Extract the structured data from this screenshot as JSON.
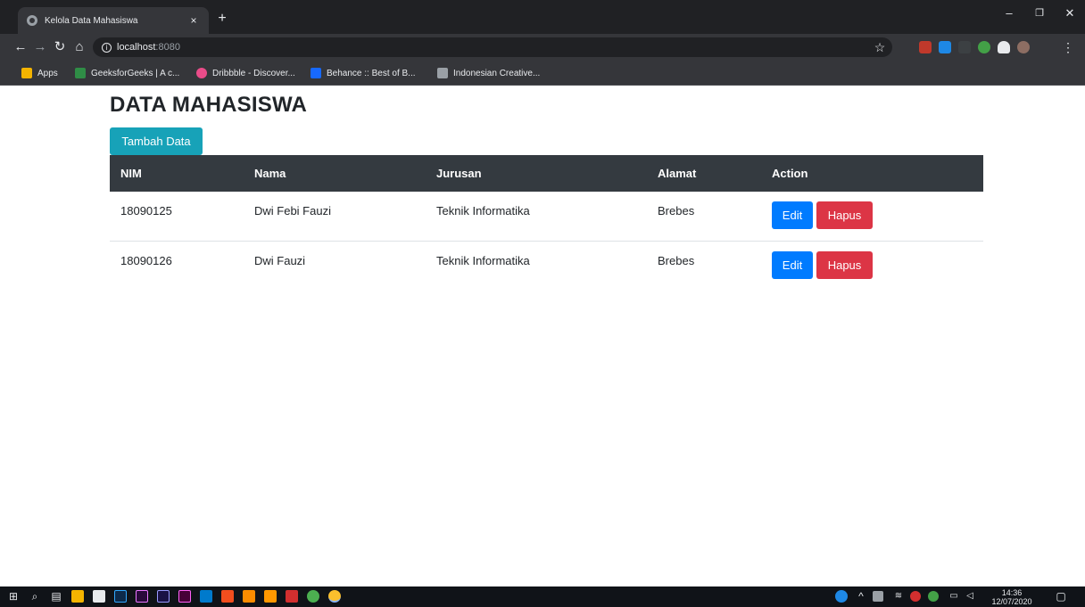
{
  "browser": {
    "tab_title": "Kelola Data Mahasiswa",
    "tab_close": "×",
    "new_tab": "+",
    "url_host": "localhost",
    "url_port": ":8080",
    "window_controls": {
      "minimize": "–",
      "restore": "❐",
      "close": "✕"
    },
    "bookmarks": [
      {
        "label": "Apps",
        "color": "#f4b400"
      },
      {
        "label": "GeeksforGeeks | A c...",
        "color": "#2f8d46"
      },
      {
        "label": "Dribbble - Discover...",
        "color": "#ea4c89"
      },
      {
        "label": "Behance :: Best of B...",
        "color": "#1769ff"
      },
      {
        "label": "Indonesian Creative...",
        "color": "#9aa0a6"
      }
    ]
  },
  "page": {
    "title": "DATA MAHASISWA",
    "add_button": "Tambah Data",
    "table": {
      "headers": [
        "NIM",
        "Nama",
        "Jurusan",
        "Alamat",
        "Action"
      ],
      "rows": [
        {
          "nim": "18090125",
          "nama": "Dwi Febi Fauzi",
          "jurusan": "Teknik Informatika",
          "alamat": "Brebes"
        },
        {
          "nim": "18090126",
          "nama": "Dwi Fauzi",
          "jurusan": "Teknik Informatika",
          "alamat": "Brebes"
        }
      ],
      "edit_label": "Edit",
      "delete_label": "Hapus"
    }
  },
  "taskbar": {
    "time": "14:36",
    "date": "12/07/2020"
  },
  "colors": {
    "header_bg": "#343a40",
    "info_button": "#17a2b8",
    "primary_button": "#007bff",
    "danger_button": "#dc3545"
  }
}
